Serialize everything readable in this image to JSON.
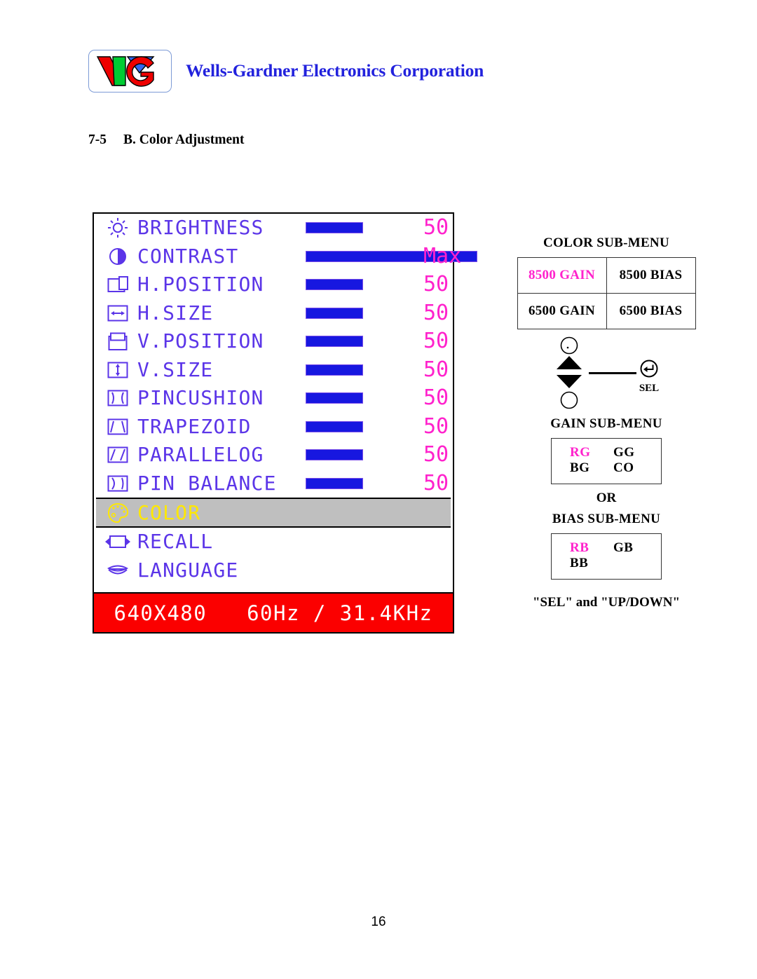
{
  "header": {
    "logo_alt": "wells-gardner-logo",
    "company_title": "Wells-Gardner Electronics Corporation",
    "logo_colors": {
      "red": "#ee0000",
      "green": "#00cc33",
      "blue": "#3366ee"
    },
    "title_color": "#2222dd"
  },
  "section": {
    "number": "7-5",
    "title": "B. Color Adjustment"
  },
  "osd": {
    "label_color": "#5b35e8",
    "value_color": "#ff22cc",
    "bar_color": "#1717e0",
    "highlight_bg": "#bfbfbf",
    "highlight_text_color": "#ffe800",
    "status_bg": "#fb0000",
    "status_text_color": "#ffffff",
    "rows": [
      {
        "icon": "brightness-sun-icon",
        "label": "BRIGHTNESS",
        "bar_pct": 50,
        "value": "50",
        "has_bar": true
      },
      {
        "icon": "contrast-halfcircle-icon",
        "label": "CONTRAST",
        "bar_pct": 100,
        "value": "Max",
        "has_bar": true
      },
      {
        "icon": "h-position-icon",
        "label": "H.POSITION",
        "bar_pct": 50,
        "value": "50",
        "has_bar": true
      },
      {
        "icon": "h-size-icon",
        "label": "H.SIZE",
        "bar_pct": 50,
        "value": "50",
        "has_bar": true
      },
      {
        "icon": "v-position-icon",
        "label": "V.POSITION",
        "bar_pct": 50,
        "value": "50",
        "has_bar": true
      },
      {
        "icon": "v-size-icon",
        "label": "V.SIZE",
        "bar_pct": 50,
        "value": "50",
        "has_bar": true
      },
      {
        "icon": "pincushion-icon",
        "label": "PINCUSHION",
        "bar_pct": 50,
        "value": "50",
        "has_bar": true
      },
      {
        "icon": "trapezoid-icon",
        "label": "TRAPEZOID",
        "bar_pct": 50,
        "value": "50",
        "has_bar": true
      },
      {
        "icon": "parallelogram-icon",
        "label": "PARALLELOG",
        "bar_pct": 50,
        "value": "50",
        "has_bar": true
      },
      {
        "icon": "pin-balance-icon",
        "label": "PIN BALANCE",
        "bar_pct": 50,
        "value": "50",
        "has_bar": true
      },
      {
        "icon": "palette-icon",
        "label": "COLOR",
        "value": "",
        "has_bar": false,
        "selected": true
      },
      {
        "icon": "recall-icon",
        "label": "RECALL",
        "value": "",
        "has_bar": false
      },
      {
        "icon": "language-icon",
        "label": "LANGUAGE",
        "value": "",
        "has_bar": false
      }
    ],
    "status_bar": "640X480   60Hz / 31.4KHz"
  },
  "color_submenu": {
    "title": "COLOR SUB-MENU",
    "cells": [
      [
        {
          "label": "8500 GAIN",
          "selected": true
        },
        {
          "label": "8500 BIAS",
          "selected": false
        }
      ],
      [
        {
          "label": "6500 GAIN",
          "selected": false
        },
        {
          "label": "6500 BIAS",
          "selected": false
        }
      ]
    ],
    "selected_color": "#ff22cc"
  },
  "nav": {
    "up_icon": "up-triangle-icon",
    "down_icon": "down-triangle-icon",
    "top_circle_icon": "circle-button-icon",
    "bottom_circle_icon": "circle-button-icon",
    "sel_icon": "enter-return-icon",
    "sel_label": "SEL"
  },
  "gain_submenu": {
    "title": "GAIN SUB-MENU",
    "rows": [
      [
        {
          "label": "RG",
          "selected": true
        },
        {
          "label": "GG",
          "selected": false
        }
      ],
      [
        {
          "label": "BG",
          "selected": false
        },
        {
          "label": "CO",
          "selected": false
        }
      ]
    ]
  },
  "or_label": "OR",
  "bias_submenu": {
    "title": "BIAS SUB-MENU",
    "rows": [
      [
        {
          "label": "RB",
          "selected": true
        },
        {
          "label": "GB",
          "selected": false
        }
      ],
      [
        {
          "label": "BB",
          "selected": false
        },
        {
          "label": "",
          "selected": false
        }
      ]
    ]
  },
  "footnote": "\"SEL\" and \"UP/DOWN\"",
  "page_number": "16"
}
